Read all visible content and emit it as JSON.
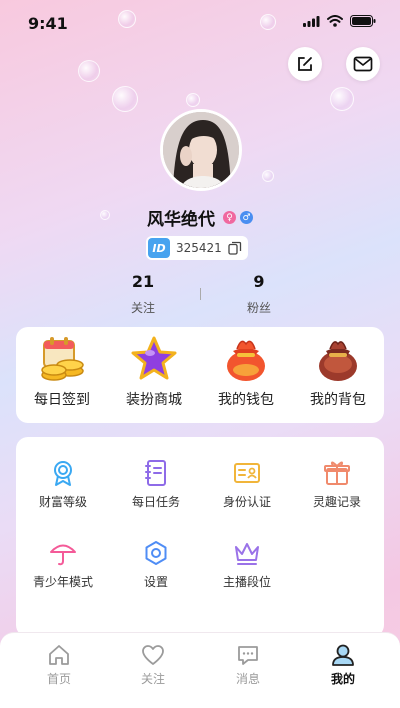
{
  "status_bar": {
    "time": "9:41"
  },
  "profile": {
    "username": "风华绝代",
    "id_badge": "ID",
    "id_number": "325421",
    "stats": [
      {
        "value": "21",
        "label": "关注"
      },
      {
        "value": "9",
        "label": "粉丝"
      }
    ]
  },
  "quick_actions": [
    {
      "label": "每日签到",
      "icon": "calendar-coins-icon"
    },
    {
      "label": "装扮商城",
      "icon": "star-icon"
    },
    {
      "label": "我的钱包",
      "icon": "lucky-bag-icon"
    },
    {
      "label": "我的背包",
      "icon": "treasure-bag-icon"
    }
  ],
  "functions": [
    {
      "label": "财富等级",
      "icon": "medal-icon",
      "color": "#3aa8f2"
    },
    {
      "label": "每日任务",
      "icon": "notebook-icon",
      "color": "#8e6be8"
    },
    {
      "label": "身份认证",
      "icon": "id-card-icon",
      "color": "#f1b53a"
    },
    {
      "label": "灵趣记录",
      "icon": "gift-icon",
      "color": "#f08a6c"
    },
    {
      "label": "青少年模式",
      "icon": "umbrella-icon",
      "color": "#f45a98"
    },
    {
      "label": "设置",
      "icon": "settings-icon",
      "color": "#4f8df5"
    },
    {
      "label": "主播段位",
      "icon": "crown-icon",
      "color": "#9a72e8"
    }
  ],
  "tabs": [
    {
      "label": "首页",
      "icon": "home-icon",
      "active": false
    },
    {
      "label": "关注",
      "icon": "heart-icon",
      "active": false
    },
    {
      "label": "消息",
      "icon": "message-icon",
      "active": false
    },
    {
      "label": "我的",
      "icon": "profile-icon",
      "active": true
    }
  ]
}
